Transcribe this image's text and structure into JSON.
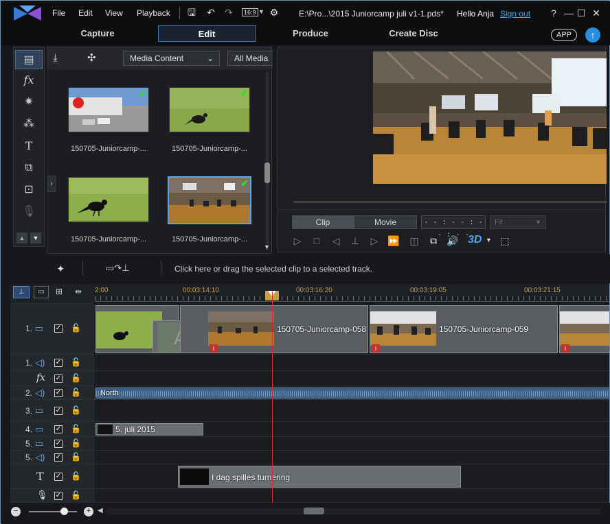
{
  "menu": [
    "File",
    "Edit",
    "View",
    "Playback"
  ],
  "aspect": "16:9",
  "file_title": "E:\\Pro...\\2015 Juniorcamp juli v1-1.pds*",
  "user": {
    "greeting": "Hello Anja",
    "signout": "Sign out"
  },
  "window_buttons": {
    "help": "?",
    "minimize": "—",
    "maximize": "☐",
    "close": "✕"
  },
  "tabs": [
    "Capture",
    "Edit",
    "Produce",
    "Create Disc"
  ],
  "app_label": "APP",
  "library": {
    "media_dropdown": "Media Content",
    "filter_dropdown": "All Media",
    "items": [
      {
        "label": "150705-Juniorcamp-..."
      },
      {
        "label": "150705-Juniorcamp-..."
      },
      {
        "label": "150705-Juniorcamp-..."
      },
      {
        "label": "150705-Juniorcamp-..."
      }
    ]
  },
  "preview": {
    "clip_label": "Clip",
    "movie_label": "Movie",
    "timecode": "- - : - - : - - : - -",
    "fit_label": "Fit",
    "three_d": "3D"
  },
  "action_hint": "Click here or drag the selected clip to a selected track.",
  "ruler": [
    "2:00",
    "00:03:14:10",
    "00:03:16:20",
    "00:03:19:05",
    "00:03:21:15"
  ],
  "tracks": [
    {
      "num": "1.",
      "type": "video"
    },
    {
      "num": "1.",
      "type": "audio"
    },
    {
      "num": "",
      "type": "fx"
    },
    {
      "num": "2.",
      "type": "audio"
    },
    {
      "num": "3.",
      "type": "video"
    },
    {
      "num": "4.",
      "type": "video"
    },
    {
      "num": "5.",
      "type": "video"
    },
    {
      "num": "5.",
      "type": "audio"
    },
    {
      "num": "",
      "type": "title"
    },
    {
      "num": "",
      "type": "voice"
    }
  ],
  "clips": {
    "clip_058": "150705-Juniorcamp-058",
    "clip_059": "150705-Juniorcamp-059",
    "audio_north": "North",
    "date_title": "5. juli 2015",
    "title_text": "I dag spilles turnering"
  }
}
